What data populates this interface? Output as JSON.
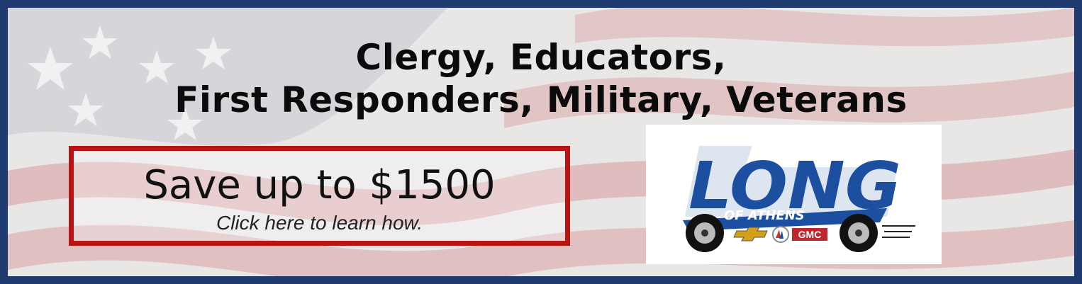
{
  "banner": {
    "headline_line1": "Clergy, Educators,",
    "headline_line2": "First Responders, Military, Veterans",
    "offer_title": "Save up to $1500",
    "offer_subtitle": "Click here to learn how.",
    "logo": {
      "word": "LONG",
      "subword": "OF ATHENS",
      "brands": [
        "Chevrolet",
        "Buick",
        "GMC"
      ],
      "gmc_text": "GMC"
    }
  },
  "colors": {
    "border": "#1f3a6e",
    "offer_border": "#b81414",
    "logo_blue": "#1d4fa0",
    "flag_red": "#c8585a",
    "flag_blue": "#2b3f73"
  }
}
